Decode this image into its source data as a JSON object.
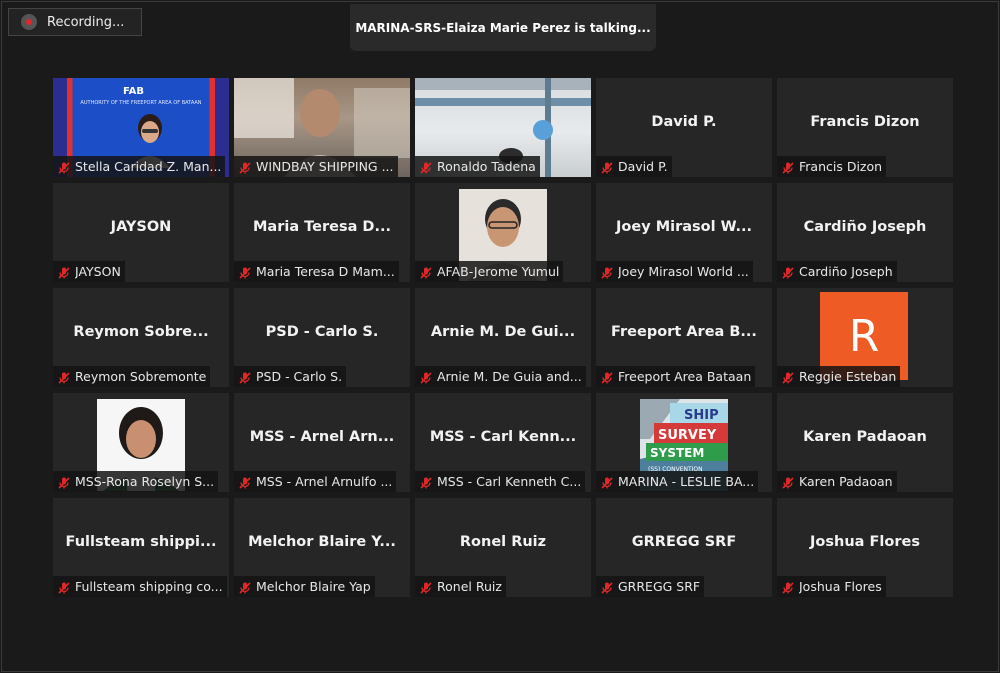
{
  "recording": {
    "label": "Recording..."
  },
  "talking": {
    "text": "MARINA-SRS-Elaiza Marie Perez is talking..."
  },
  "tiles": [
    {
      "label": "Stella Caridad Z. Man...",
      "kind": "afab",
      "logo": "FAB",
      "sub": "AUTHORITY OF THE FREEPORT AREA OF BATAAN"
    },
    {
      "label": "WINDBAY SHIPPING ...",
      "kind": "windbay"
    },
    {
      "label": "Ronaldo Tadena",
      "kind": "ronaldo"
    },
    {
      "label": "David P.",
      "center": "David P."
    },
    {
      "label": "Francis Dizon",
      "center": "Francis Dizon"
    },
    {
      "label": "JAYSON",
      "center": "JAYSON"
    },
    {
      "label": "Maria Teresa D Mam...",
      "center": "Maria Teresa D..."
    },
    {
      "label": "AFAB-Jerome Yumul",
      "kind": "jerome"
    },
    {
      "label": "Joey Mirasol World ...",
      "center": "Joey Mirasol W..."
    },
    {
      "label": "Cardiño Joseph",
      "center": "Cardiño Joseph"
    },
    {
      "label": "Reymon Sobremonte",
      "center": "Reymon Sobre..."
    },
    {
      "label": "PSD - Carlo S.",
      "center": "PSD - Carlo S."
    },
    {
      "label": "Arnie M. De Guia and...",
      "center": "Arnie M. De Gui..."
    },
    {
      "label": "Freeport Area Bataan",
      "center": "Freeport Area B..."
    },
    {
      "label": "Reggie Esteban",
      "kind": "reggie",
      "initial": "R"
    },
    {
      "label": "MSS-Rona Roselyn S...",
      "kind": "rona"
    },
    {
      "label": "MSS - Arnel Arnulfo ...",
      "center": "MSS - Arnel Arn..."
    },
    {
      "label": "MSS - Carl Kenneth C...",
      "center": "MSS - Carl Kenn..."
    },
    {
      "label": "MARINA - LESLIE BA...",
      "kind": "ship",
      "ship_text": [
        "SHIP",
        "SURVEY",
        "SYSTEM",
        "(SS) CONVENTION"
      ]
    },
    {
      "label": "Karen Padaoan",
      "center": "Karen Padaoan"
    },
    {
      "label": "Fullsteam shipping co...",
      "center": "Fullsteam shippi..."
    },
    {
      "label": "Melchor Blaire Yap",
      "center": "Melchor Blaire Y..."
    },
    {
      "label": "Ronel Ruiz",
      "center": "Ronel Ruiz"
    },
    {
      "label": "GRREGG SRF",
      "center": "GRREGG SRF"
    },
    {
      "label": "Joshua Flores",
      "center": "Joshua Flores"
    }
  ],
  "colors": {
    "background": "#1a1a1a",
    "tile": "#262626",
    "muted_mic": "#e02828",
    "avatar_orange": "#ef5b25"
  },
  "icons": {
    "mic": "muted-mic-icon",
    "recording": "recording-icon"
  }
}
